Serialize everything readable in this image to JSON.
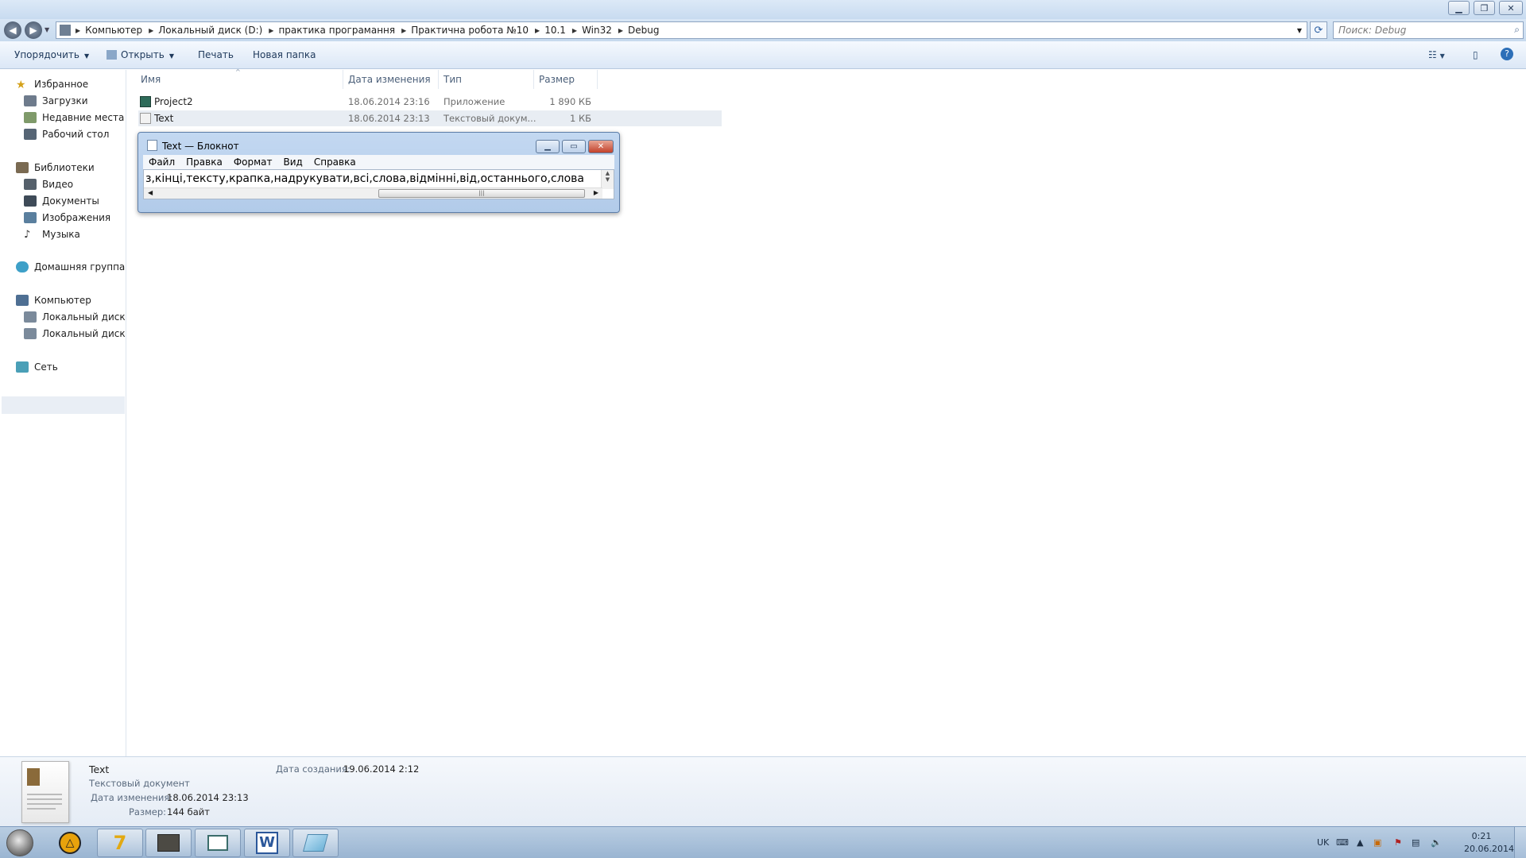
{
  "explorer": {
    "breadcrumb": [
      "Компьютер",
      "Локальный диск (D:)",
      "практика програмання",
      "Практична робота №10",
      "10.1",
      "Win32",
      "Debug"
    ],
    "search_placeholder": "Поиск: Debug",
    "toolbar": {
      "organize": "Упорядочить",
      "open": "Открыть",
      "print": "Печать",
      "new_folder": "Новая папка"
    },
    "nav": {
      "favorites": "Избранное",
      "downloads": "Загрузки",
      "recent": "Недавние места",
      "desktop": "Рабочий стол",
      "libraries": "Библиотеки",
      "video": "Видео",
      "documents": "Документы",
      "images": "Изображения",
      "music": "Музыка",
      "homegroup": "Домашняя группа",
      "computer": "Компьютер",
      "disk_c": "Локальный диск (C",
      "disk_d": "Локальный диск (D",
      "network": "Сеть"
    },
    "columns": {
      "name": "Имя",
      "date": "Дата изменения",
      "type": "Тип",
      "size": "Размер"
    },
    "files": [
      {
        "name": "Project2",
        "date": "18.06.2014 23:16",
        "type": "Приложение",
        "size": "1 890 КБ"
      },
      {
        "name": "Text",
        "date": "18.06.2014 23:13",
        "type": "Текстовый докум...",
        "size": "1 КБ"
      }
    ],
    "details": {
      "name": "Text",
      "kind": "Текстовый документ",
      "modified_label": "Дата изменения:",
      "modified_value": "18.06.2014 23:13",
      "size_label": "Размер:",
      "size_value": "144 байт",
      "created_label": "Дата создания:",
      "created_value": "19.06.2014 2:12"
    }
  },
  "notepad": {
    "title": "Text — Блокнот",
    "menu": [
      "Файл",
      "Правка",
      "Формат",
      "Вид",
      "Справка"
    ],
    "content": "з,кінці,тексту,крапка,надрукувати,всі,слова,відмінні,від,останнього,слова"
  },
  "taskbar": {
    "lang": "UK",
    "time": "0:21",
    "date": "20.06.2014"
  }
}
